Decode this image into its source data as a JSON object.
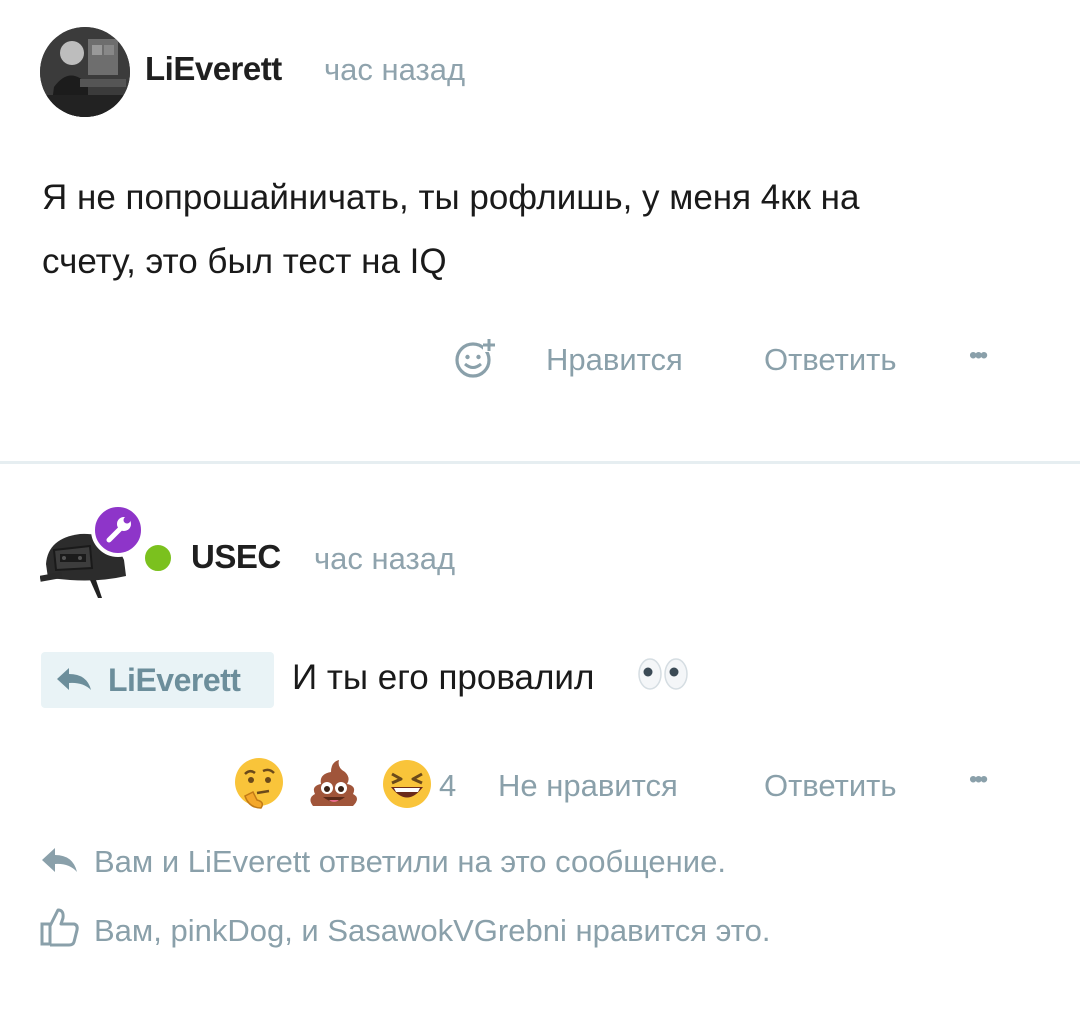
{
  "post1": {
    "username": "LiEverett",
    "time": "час назад",
    "message_line1": "Я не попрошайничать, ты рофлишь, у меня 4кк на",
    "message_line2": "счету, это был тест на IQ",
    "actions": {
      "like": "Нравится",
      "reply": "Ответить",
      "more": "•••"
    }
  },
  "post2": {
    "username": "USEC",
    "time": "час назад",
    "online": true,
    "quote_user": "LiEverett",
    "message": "И ты его провалил",
    "reactions": [
      {
        "icon": "thinking-face-icon"
      },
      {
        "icon": "poop-icon"
      },
      {
        "icon": "laughing-face-icon"
      }
    ],
    "reaction_count": "4",
    "actions": {
      "dislike": "Не нравится",
      "reply": "Ответить",
      "more": "•••"
    },
    "replied_notice": "Вам и LiEverett ответили на это сообщение.",
    "liked_notice": "Вам, pinkDog, и SasawokVGrebni нравится это."
  },
  "colors": {
    "muted": "#8aa0aa",
    "quote_bg": "#e9f3f6",
    "online": "#7bc11e",
    "badge": "#8e35c9"
  }
}
